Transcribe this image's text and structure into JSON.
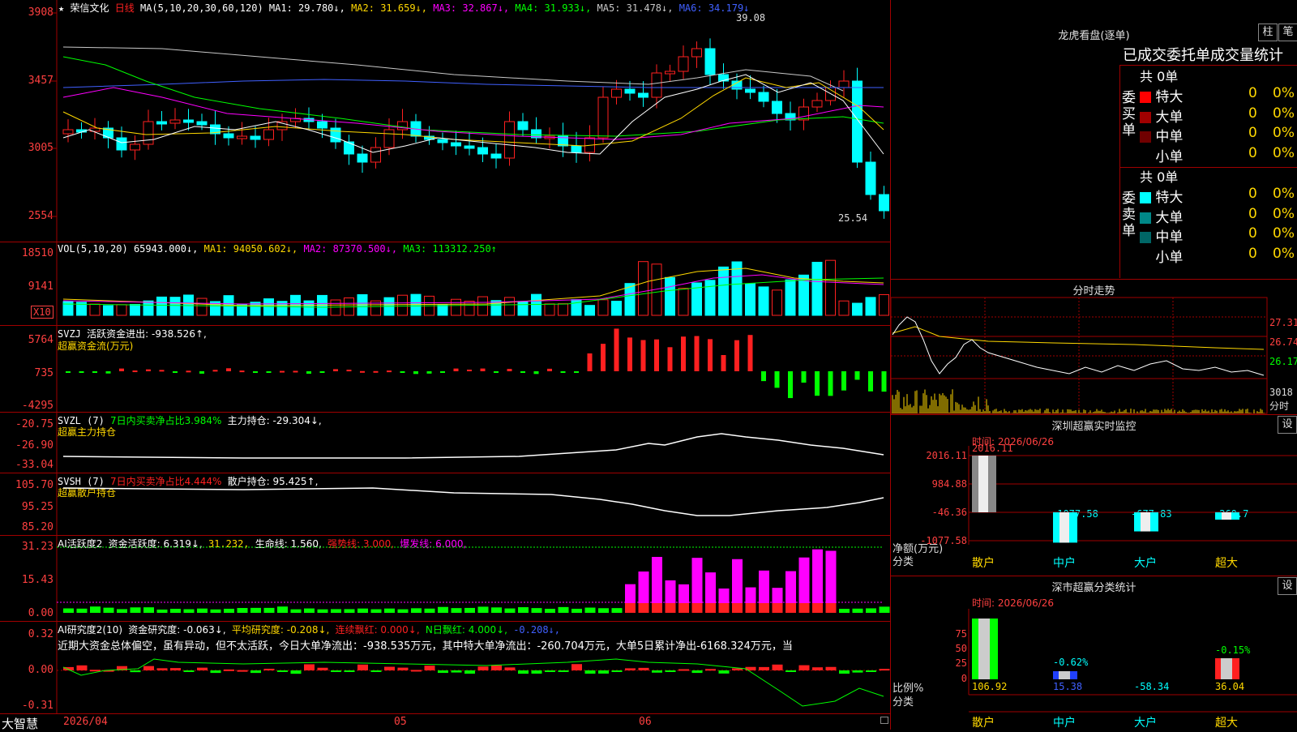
{
  "header": {
    "star": "★",
    "stock_name": "荣信文化",
    "period": "日线",
    "ma_label": "MA(5,10,20,30,60,120)",
    "ma1": "MA1: 29.780↓,",
    "ma2": "MA2: 31.659↓,",
    "ma3": "MA3: 32.867↓,",
    "ma4": "MA4: 31.933↓,",
    "ma5": "MA5: 31.478↓,",
    "ma6": "MA6: 34.179↓",
    "high_mark": "39.08",
    "low_mark": "25.54"
  },
  "price_axis": [
    "3908",
    "3457",
    "3005",
    "2554"
  ],
  "vol": {
    "label": "VOL(5,10,20)",
    "val": "65943.000↓,",
    "ma1": "MA1: 94050.602↓,",
    "ma2": "MA2: 87370.500↓,",
    "ma3": "MA3: 113312.250↑",
    "axis": [
      "18510",
      "9141"
    ],
    "unit": "X10"
  },
  "svzj": {
    "label": "SVZJ",
    "text": "活跃资金进出: -938.526↑,",
    "sub": "超赢资金流(万元)",
    "axis": [
      "5764",
      "735",
      "-4295"
    ]
  },
  "svzl": {
    "label": "SVZL (7)",
    "t1": "7日内买卖净占比3.984%",
    "t2": "主力持仓: -29.304↓,",
    "sub": "超赢主力持仓",
    "axis": [
      "-20.75",
      "-26.90",
      "-33.04"
    ]
  },
  "svsh": {
    "label": "SVSH (7)",
    "t1": "7日内买卖净占比4.444%",
    "t2": "散户持仓: 95.425↑,",
    "sub": "超赢散户持仓",
    "axis": [
      "105.70",
      "95.25",
      "85.20"
    ]
  },
  "ai1": {
    "label": "AI活跃度2",
    "t1": "资金活跃度: 6.319↓,",
    "t2": "31.232,",
    "t3": "生命线: 1.560,",
    "t4": "强势线: 3.000,",
    "t5": "爆发线: 6.000,",
    "axis": [
      "31.23",
      "15.43",
      "0.00"
    ]
  },
  "ai2": {
    "label": "AI研究度2(10)",
    "t1": "资金研究度: -0.063↓,",
    "t2": "平均研究度: -0.208↓,",
    "t3": "连续飘红: 0.000↓,",
    "t4": "N日飘红: 4.000↓,",
    "t5": "-0.208↓,",
    "desc": "近期大资金总体偏空，虽有异动，但不太活跃，今日大单净流出：-938.535万元，其中特大单净流出：-260.704万元，大单5日累计净出-6168.324万元，当",
    "axis": [
      "0.32",
      "0.00",
      "-0.31"
    ]
  },
  "bottom": {
    "brand": "大智慧",
    "date1": "2026/04",
    "m1": "05",
    "m2": "06"
  },
  "lhb": {
    "title": "龙虎看盘(逐单)",
    "btn1": "柱",
    "btn2": "笔",
    "sub": "已成交委托单成交量统计",
    "buy_side": "委买单",
    "sell_side": "委卖单",
    "buy_total": "共 0单",
    "sell_total": "共 0单",
    "buy_rows": [
      {
        "name": "特大",
        "val": "0",
        "pct": "0%",
        "color": "#ff0000"
      },
      {
        "name": "大单",
        "val": "0",
        "pct": "0%",
        "color": "#a00000"
      },
      {
        "name": "中单",
        "val": "0",
        "pct": "0%",
        "color": "#700000"
      },
      {
        "name": "小单",
        "val": "0",
        "pct": "0%",
        "color": "#000000"
      }
    ],
    "sell_rows": [
      {
        "name": "特大",
        "val": "0",
        "pct": "0%",
        "color": "#00ffff"
      },
      {
        "name": "大单",
        "val": "0",
        "pct": "0%",
        "color": "#008888"
      },
      {
        "name": "中单",
        "val": "0",
        "pct": "0%",
        "color": "#006666"
      },
      {
        "name": "小单",
        "val": "0",
        "pct": "0%",
        "color": "#000000"
      }
    ]
  },
  "fenshi": {
    "title": "分时走势",
    "p1": "27.31",
    "p2": "26.74",
    "p3": "26.17",
    "vol": "3018",
    "unit": "分时"
  },
  "monitor": {
    "title": "深圳超赢实时监控",
    "btn": "设",
    "time": "时间: 2026/06/26",
    "axis": [
      "2016.11",
      "984.88",
      "-46.36",
      "-1077.58"
    ],
    "top_label": "2016.11",
    "ylabel": "净额(万元)",
    "xlabel": "分类",
    "cats": [
      "散户",
      "中户",
      "大户",
      "超大"
    ],
    "values": [
      2016.11,
      -1077.58,
      -677.83,
      -260.7
    ],
    "vlabels": [
      "-1077.58",
      "-677.83",
      "-260.7"
    ]
  },
  "classify": {
    "title": "深市超赢分类统计",
    "btn": "设",
    "time": "时间: 2026/06/26",
    "axis": [
      "75",
      "50",
      "25",
      "0"
    ],
    "ylabel": "比例%",
    "xlabel": "分类",
    "cats": [
      "散户",
      "中户",
      "大户",
      "超大"
    ],
    "pcts": [
      "-0.62%",
      "-0.15%"
    ],
    "bottoms": [
      "106.92",
      "15.38",
      "-58.34",
      "36.04"
    ]
  },
  "colors": {
    "up": "#ff2020",
    "down": "#00ffff",
    "grid": "#a00000",
    "yellow": "#ffd800",
    "magenta": "#ff00ff",
    "green": "#00ff00"
  }
}
